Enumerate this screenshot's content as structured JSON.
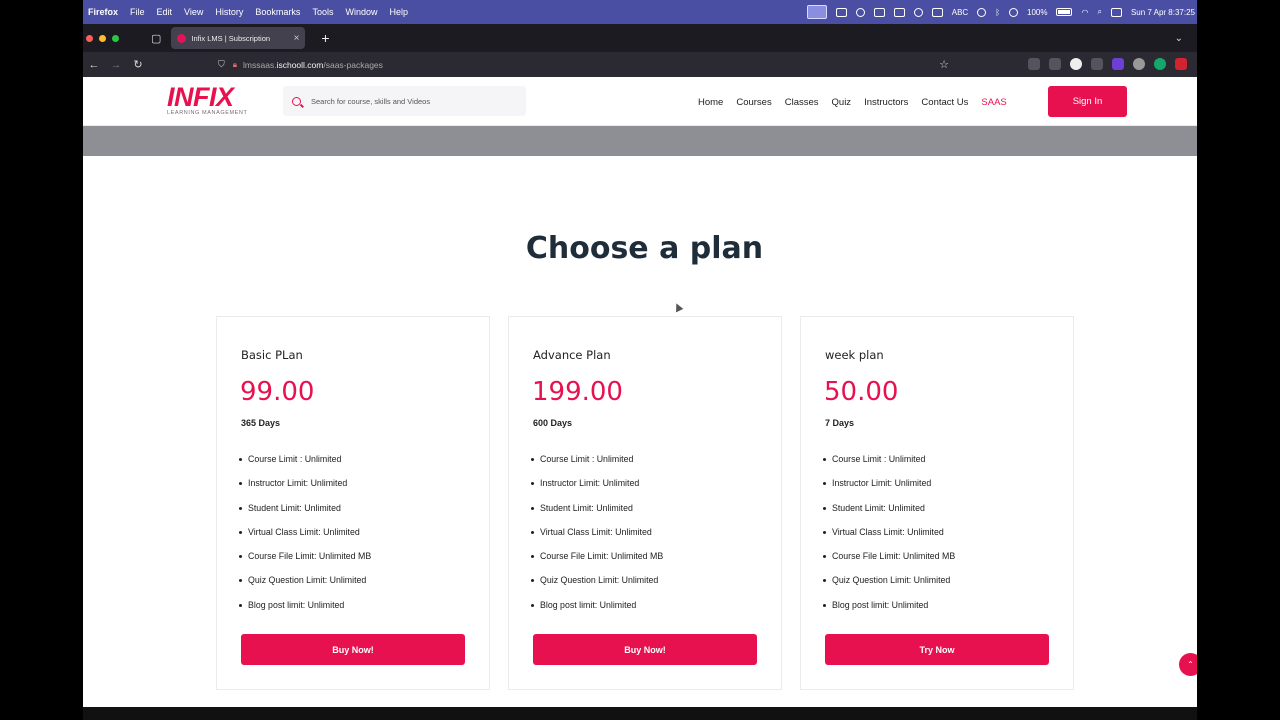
{
  "menubar": {
    "app": "Firefox",
    "menus": [
      "File",
      "Edit",
      "View",
      "History",
      "Bookmarks",
      "Tools",
      "Window",
      "Help"
    ],
    "status": {
      "keyboard": "ABC",
      "battery": "100%",
      "datetime": "Sun 7 Apr  8:37:25"
    }
  },
  "browser": {
    "tab_title": "Infix LMS | Subscription",
    "tab_close": "×",
    "new_tab": "+",
    "url_host": "lmssaas.",
    "url_domain": "ischooll.com",
    "url_path": "/saas-packages"
  },
  "site": {
    "logo_text": "INFIX",
    "logo_subtitle": "LEARNING MANAGEMENT",
    "search_placeholder": "Search for course, skills and Videos",
    "nav": [
      "Home",
      "Courses",
      "Classes",
      "Quiz",
      "Instructors",
      "Contact Us",
      "SAAS"
    ],
    "active_nav": "SAAS",
    "signin_label": "Sign In",
    "heading": "Choose a plan",
    "accent_color": "#e8114f"
  },
  "plans": [
    {
      "name": "Basic PLan",
      "price": "99.00",
      "duration": "365 Days",
      "features": [
        "Course Limit : Unlimited",
        "Instructor Limit: Unlimited",
        "Student Limit: Unlimited",
        "Virtual Class Limit: Unlimited",
        "Course File Limit: Unlimited MB",
        "Quiz Question Limit: Unlimited",
        "Blog post limit: Unlimited"
      ],
      "cta": "Buy Now!"
    },
    {
      "name": "Advance Plan",
      "price": "199.00",
      "duration": "600 Days",
      "features": [
        "Course Limit : Unlimited",
        "Instructor Limit: Unlimited",
        "Student Limit: Unlimited",
        "Virtual Class Limit: Unlimited",
        "Course File Limit: Unlimited MB",
        "Quiz Question Limit: Unlimited",
        "Blog post limit: Unlimited"
      ],
      "cta": "Buy Now!"
    },
    {
      "name": "week plan",
      "price": "50.00",
      "duration": "7 Days",
      "features": [
        "Course Limit : Unlimited",
        "Instructor Limit: Unlimited",
        "Student Limit: Unlimited",
        "Virtual Class Limit: Unlimited",
        "Course File Limit: Unlimited MB",
        "Quiz Question Limit: Unlimited",
        "Blog post limit: Unlimited"
      ],
      "cta": "Try Now"
    }
  ]
}
